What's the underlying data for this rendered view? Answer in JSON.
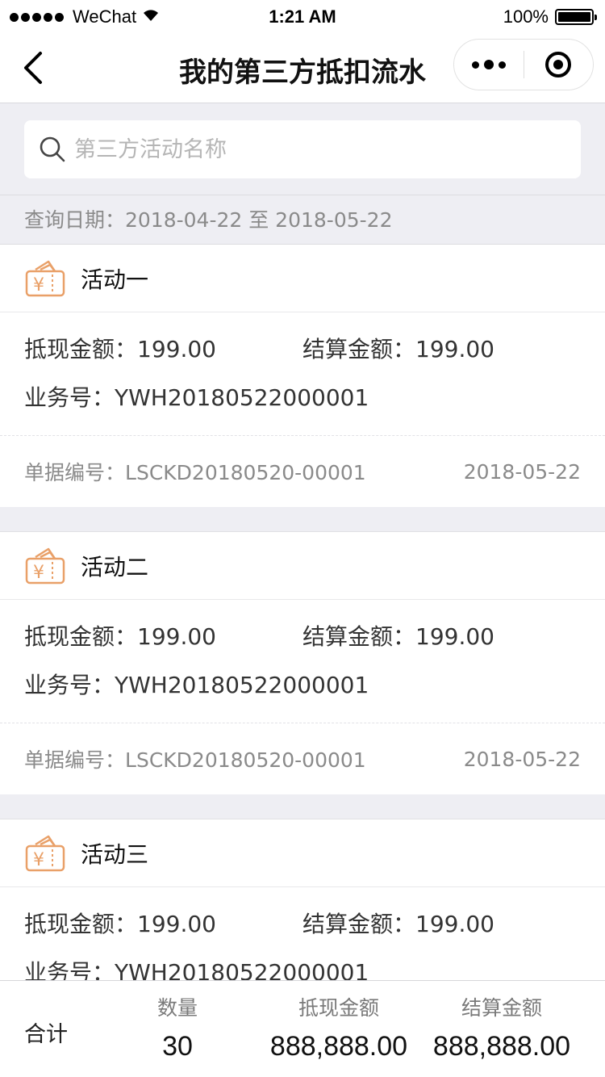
{
  "status_bar": {
    "carrier": "WeChat",
    "time": "1:21 AM",
    "battery": "100%"
  },
  "nav": {
    "title": "我的第三方抵扣流水"
  },
  "search": {
    "placeholder": "第三方活动名称"
  },
  "query_date": "查询日期：2018-04-22 至 2018-05-22",
  "labels": {
    "cash_amount": "抵现金额：",
    "settle_amount": "结算金额：",
    "biz_no": "业务号：",
    "doc_no": "单据编号："
  },
  "items": [
    {
      "title": "活动一",
      "cash": "199.00",
      "settle": "199.00",
      "biz_no": "YWH20180522000001",
      "doc_no": "LSCKD20180520-00001",
      "date": "2018-05-22"
    },
    {
      "title": "活动二",
      "cash": "199.00",
      "settle": "199.00",
      "biz_no": "YWH20180522000001",
      "doc_no": "LSCKD20180520-00001",
      "date": "2018-05-22"
    },
    {
      "title": "活动三",
      "cash": "199.00",
      "settle": "199.00",
      "biz_no": "YWH20180522000001",
      "doc_no": "",
      "date": ""
    }
  ],
  "footer": {
    "total_label": "合计",
    "count_label": "数量",
    "count": "30",
    "cash_label": "抵现金额",
    "cash": "888,888.00",
    "settle_label": "结算金额",
    "settle": "888,888.00"
  },
  "colors": {
    "accent": "#e9a068",
    "background": "#eeeef3"
  }
}
